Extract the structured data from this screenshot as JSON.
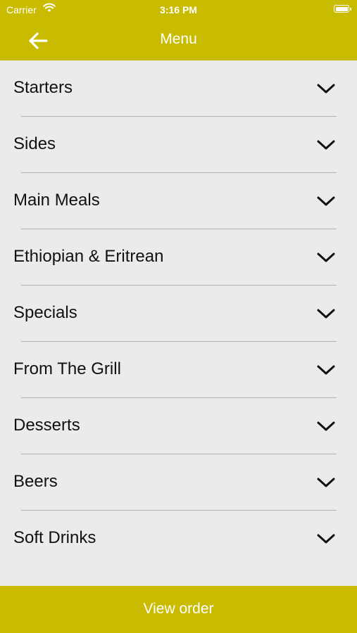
{
  "status_bar": {
    "carrier": "Carrier",
    "time": "3:16 PM"
  },
  "header": {
    "title": "Menu"
  },
  "menu": {
    "items": [
      {
        "label": "Starters"
      },
      {
        "label": "Sides"
      },
      {
        "label": "Main Meals"
      },
      {
        "label": "Ethiopian & Eritrean"
      },
      {
        "label": "Specials"
      },
      {
        "label": "From The Grill"
      },
      {
        "label": "Desserts"
      },
      {
        "label": "Beers"
      },
      {
        "label": "Soft Drinks"
      }
    ]
  },
  "footer": {
    "view_order_label": "View order"
  },
  "colors": {
    "accent": "#c9bb00",
    "background": "#ebebeb",
    "divider": "#b0b0b0"
  },
  "icons": {
    "back": "arrow-left-icon",
    "expand": "chevron-down-icon"
  }
}
